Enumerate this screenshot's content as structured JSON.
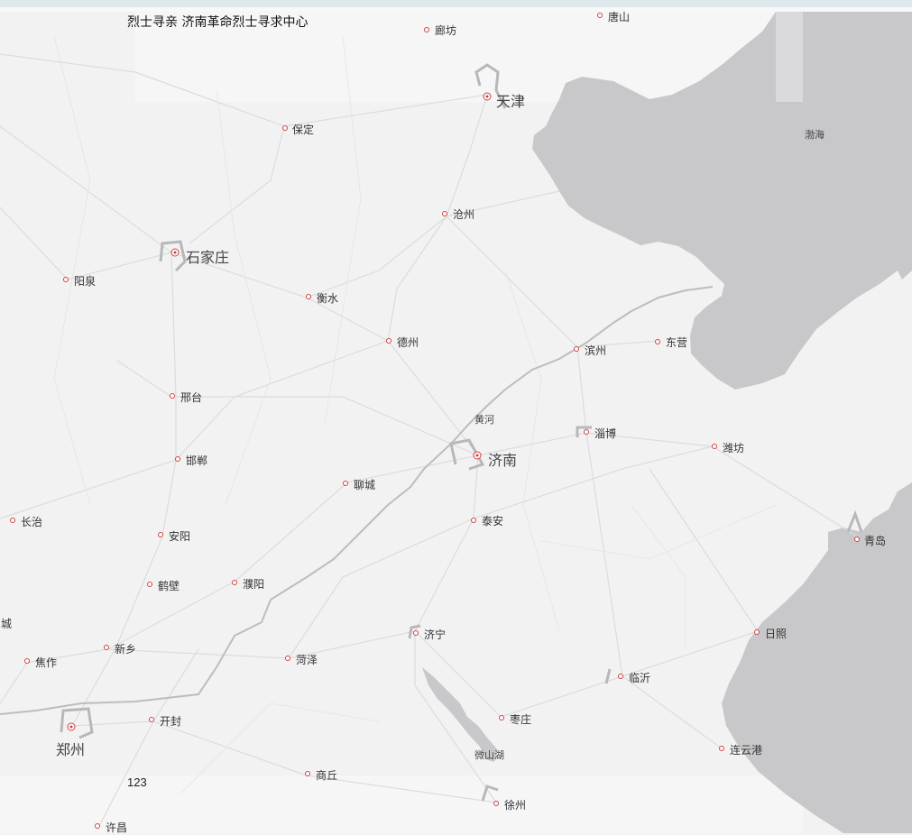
{
  "header": {
    "title": "烈士寻亲 济南革命烈士寻求中心"
  },
  "counter": "123",
  "colors": {
    "land": "#f2f2f3",
    "sea": "#c8c8ca",
    "road": "#dcdcde",
    "marker": "#d04040"
  },
  "map": {
    "cities": [
      {
        "id": "tangshan",
        "name": "唐山",
        "size": "small"
      },
      {
        "id": "langfang",
        "name": "廊坊",
        "size": "small"
      },
      {
        "id": "tianjin",
        "name": "天津",
        "size": "big"
      },
      {
        "id": "baoding",
        "name": "保定",
        "size": "small"
      },
      {
        "id": "cangzhou",
        "name": "沧州",
        "size": "small"
      },
      {
        "id": "shijiazhuang",
        "name": "石家庄",
        "size": "big"
      },
      {
        "id": "yangquan",
        "name": "阳泉",
        "size": "small"
      },
      {
        "id": "hengshui",
        "name": "衡水",
        "size": "small"
      },
      {
        "id": "dezhou",
        "name": "德州",
        "size": "small"
      },
      {
        "id": "binzhou",
        "name": "滨州",
        "size": "small"
      },
      {
        "id": "dongying",
        "name": "东营",
        "size": "small"
      },
      {
        "id": "xingtai",
        "name": "邢台",
        "size": "small"
      },
      {
        "id": "zibo",
        "name": "淄博",
        "size": "small"
      },
      {
        "id": "weifang",
        "name": "潍坊",
        "size": "small"
      },
      {
        "id": "handan",
        "name": "邯郸",
        "size": "small"
      },
      {
        "id": "jinan",
        "name": "济南",
        "size": "big"
      },
      {
        "id": "liaocheng",
        "name": "聊城",
        "size": "small"
      },
      {
        "id": "changzhi",
        "name": "长治",
        "size": "small"
      },
      {
        "id": "taian",
        "name": "泰安",
        "size": "small"
      },
      {
        "id": "anyang",
        "name": "安阳",
        "size": "small"
      },
      {
        "id": "qingdao",
        "name": "青岛",
        "size": "small"
      },
      {
        "id": "hebi",
        "name": "鹤壁",
        "size": "small"
      },
      {
        "id": "puyang",
        "name": "濮阳",
        "size": "small"
      },
      {
        "id": "jining",
        "name": "济宁",
        "size": "small"
      },
      {
        "id": "rizhao",
        "name": "日照",
        "size": "small"
      },
      {
        "id": "xinxiang",
        "name": "新乡",
        "size": "small"
      },
      {
        "id": "heze",
        "name": "菏泽",
        "size": "small"
      },
      {
        "id": "jiaozuo",
        "name": "焦作",
        "size": "small"
      },
      {
        "id": "linyi",
        "name": "临沂",
        "size": "small"
      },
      {
        "id": "kaifeng",
        "name": "开封",
        "size": "small"
      },
      {
        "id": "zaozhuang",
        "name": "枣庄",
        "size": "small"
      },
      {
        "id": "zhengzhou",
        "name": "郑州",
        "size": "big"
      },
      {
        "id": "lianyungang",
        "name": "连云港",
        "size": "small"
      },
      {
        "id": "shangqiu",
        "name": "商丘",
        "size": "small"
      },
      {
        "id": "xuzhou",
        "name": "徐州",
        "size": "small"
      },
      {
        "id": "xuchang",
        "name": "许昌",
        "size": "small"
      }
    ],
    "features": {
      "bohai": "渤海",
      "yellow_river": "黄河",
      "weishan_lake": "微山湖",
      "cut_city": "城"
    }
  }
}
